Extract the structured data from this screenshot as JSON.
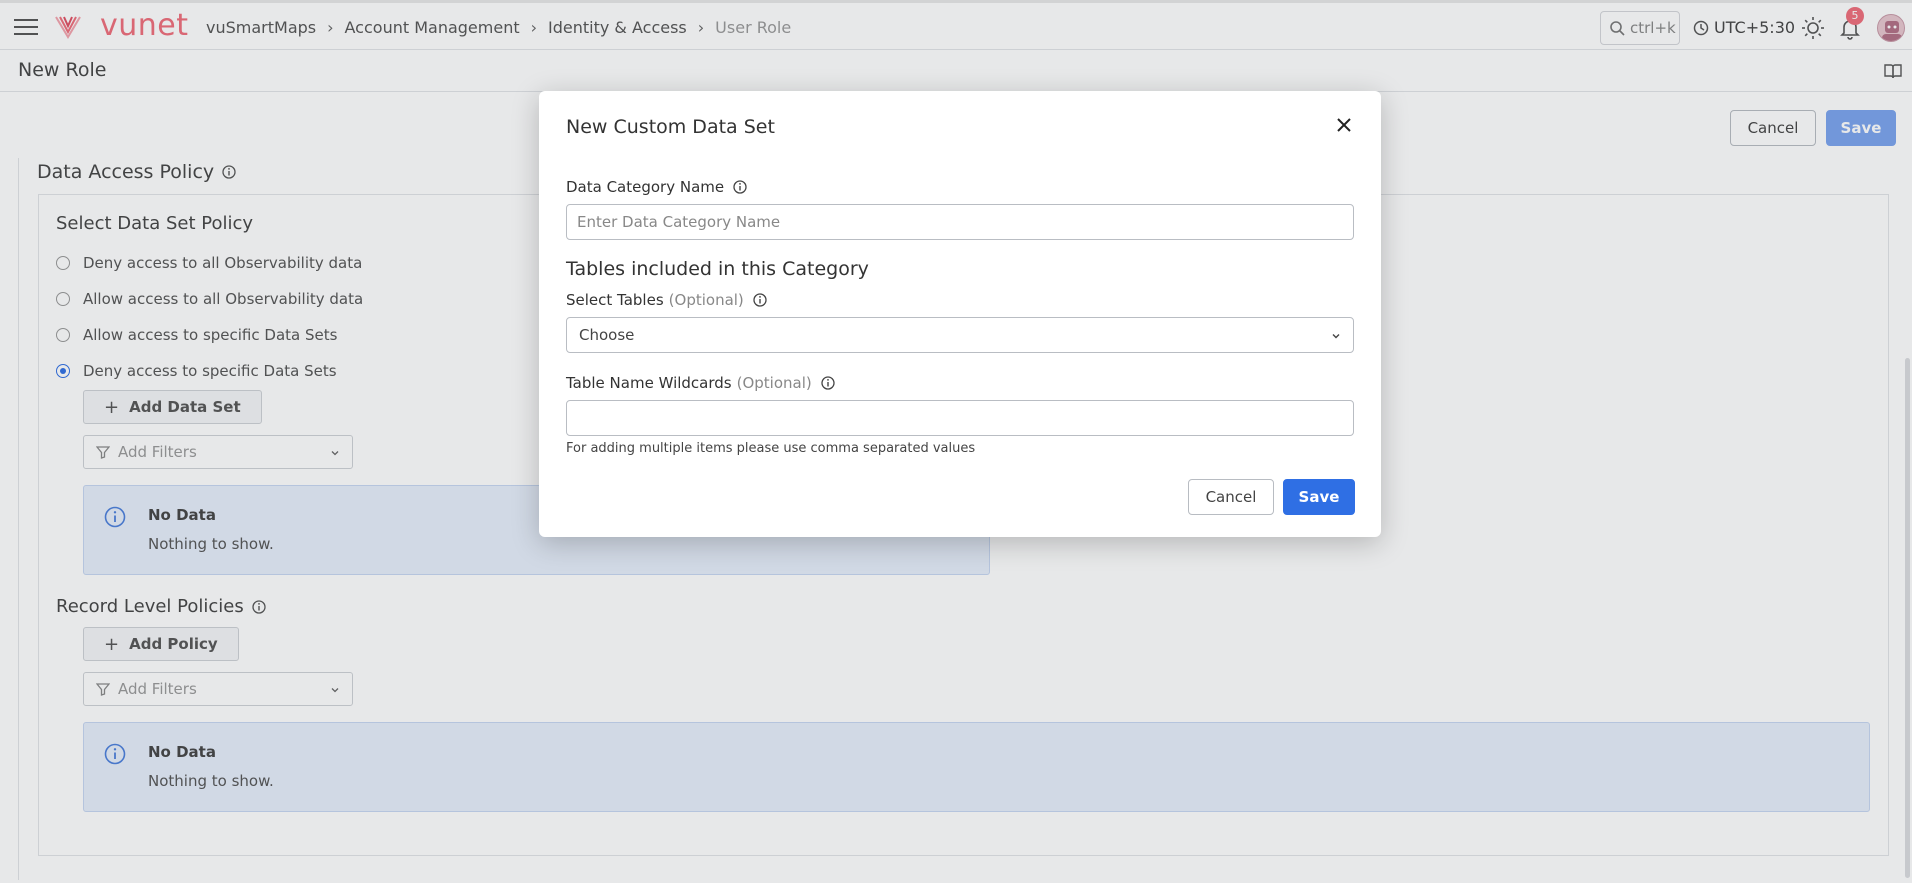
{
  "topbar": {
    "logo_text": "vunet",
    "breadcrumb": [
      "vuSmartMaps",
      "Account Management",
      "Identity & Access",
      "User Role"
    ],
    "search_placeholder": "ctrl+k",
    "timezone": "UTC+5:30",
    "notification_count": "5"
  },
  "page": {
    "title": "New Role",
    "cancel_label": "Cancel",
    "save_label": "Save"
  },
  "data_access": {
    "title": "Data Access Policy",
    "select_title": "Select Data Set Policy",
    "options": [
      "Deny access to all Observability data",
      "Allow access to all Observability data",
      "Allow access to specific Data Sets",
      "Deny access to specific Data Sets"
    ],
    "selected_index": 3,
    "add_data_set_label": "Add Data Set",
    "filter_placeholder": "Add Filters",
    "no_data_title": "No Data",
    "no_data_text": "Nothing to show."
  },
  "record_policies": {
    "title": "Record Level Policies",
    "add_policy_label": "Add Policy",
    "filter_placeholder": "Add Filters",
    "no_data_title": "No Data",
    "no_data_text": "Nothing to show."
  },
  "modal": {
    "title": "New Custom Data Set",
    "category_label": "Data Category Name",
    "category_placeholder": "Enter Data Category Name",
    "tables_section": "Tables included in this Category",
    "select_tables_label": "Select Tables",
    "optional": "(Optional)",
    "select_tables_value": "Choose",
    "wildcards_label": "Table Name Wildcards",
    "wildcards_value": "",
    "hint": "For adding multiple items please use comma separated values",
    "cancel_label": "Cancel",
    "save_label": "Save"
  },
  "colors": {
    "primary": "#2f6fe4",
    "brand": "#ef6d7a",
    "info_bg": "#e6eefb"
  }
}
